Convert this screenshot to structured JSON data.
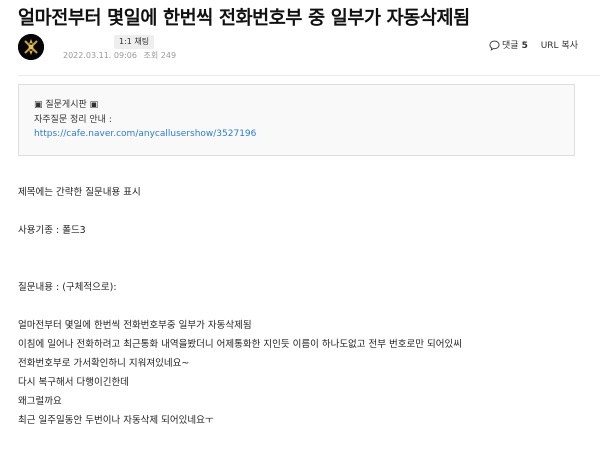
{
  "post": {
    "title": "얼마전부터 몇일에 한번씩 전화번호부 중 일부가 자동삭제됨",
    "chat_badge": "1:1 채팅",
    "date": "2022.03.11. 09:06",
    "views": "조회 249",
    "comment_label": "댓글",
    "comment_count": "5",
    "url_copy_label": "URL 복사"
  },
  "notice": {
    "line1": "▣ 질문게시판 ▣",
    "line2": "자주질문 정리 안내 :",
    "link": "https://cafe.naver.com/anycallusershow/3527196"
  },
  "body": {
    "l1": "제목에는 간략한 질문내용 표시",
    "l2": "사용기종 : 폴드3",
    "l3": "질문내용 : (구체적으로):",
    "l4": "얼마전부터 몇일에 한번씩 전화번호부중 일부가 자동삭제됨",
    "l5": "이침에 일어나 전화하려고 최근통화 내역을봤더니 어제통화한 지인듯 이름이 하나도없고 전부 번호로만 되어있씨",
    "l6": "전화번호부로 가서확인하니 지워져있네요~",
    "l7": "다시 복구해서 다행이긴한데",
    "l8": "왜그럴까요",
    "l9": "최근 일주일동안 두번이나 자동삭제 되어있네요ㅜ"
  },
  "icons": {
    "avatar": "avatar-emblem",
    "comment": "comment-bubble-icon"
  }
}
